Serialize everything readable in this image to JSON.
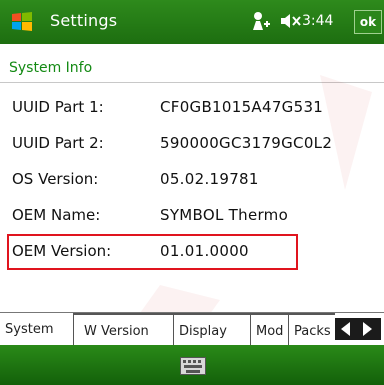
{
  "titlebar": {
    "title": "Settings",
    "clock": "3:44",
    "ok_label": "ok",
    "icons": [
      "windows-start-icon",
      "signal-icon",
      "volume-muted-icon"
    ]
  },
  "section": {
    "title": "System Info"
  },
  "rows": [
    {
      "label": "UUID Part 1:",
      "value": "CF0GB1015A47G531"
    },
    {
      "label": "UUID Part 2:",
      "value": "590000GC3179GC0L2"
    },
    {
      "label": "OS Version:",
      "value": "05.02.19781"
    },
    {
      "label": "OEM Name:",
      "value": "SYMBOL Thermo"
    },
    {
      "label": "OEM Version:",
      "value": "01.01.0000"
    }
  ],
  "tabs": [
    "System",
    "W Version",
    "Display",
    "Mod",
    "Packs"
  ],
  "colors": {
    "titlebar": "#1d6e10",
    "section_title": "#148a14",
    "highlight": "#e0141e"
  },
  "menubar": {
    "icon": "keyboard-icon"
  }
}
